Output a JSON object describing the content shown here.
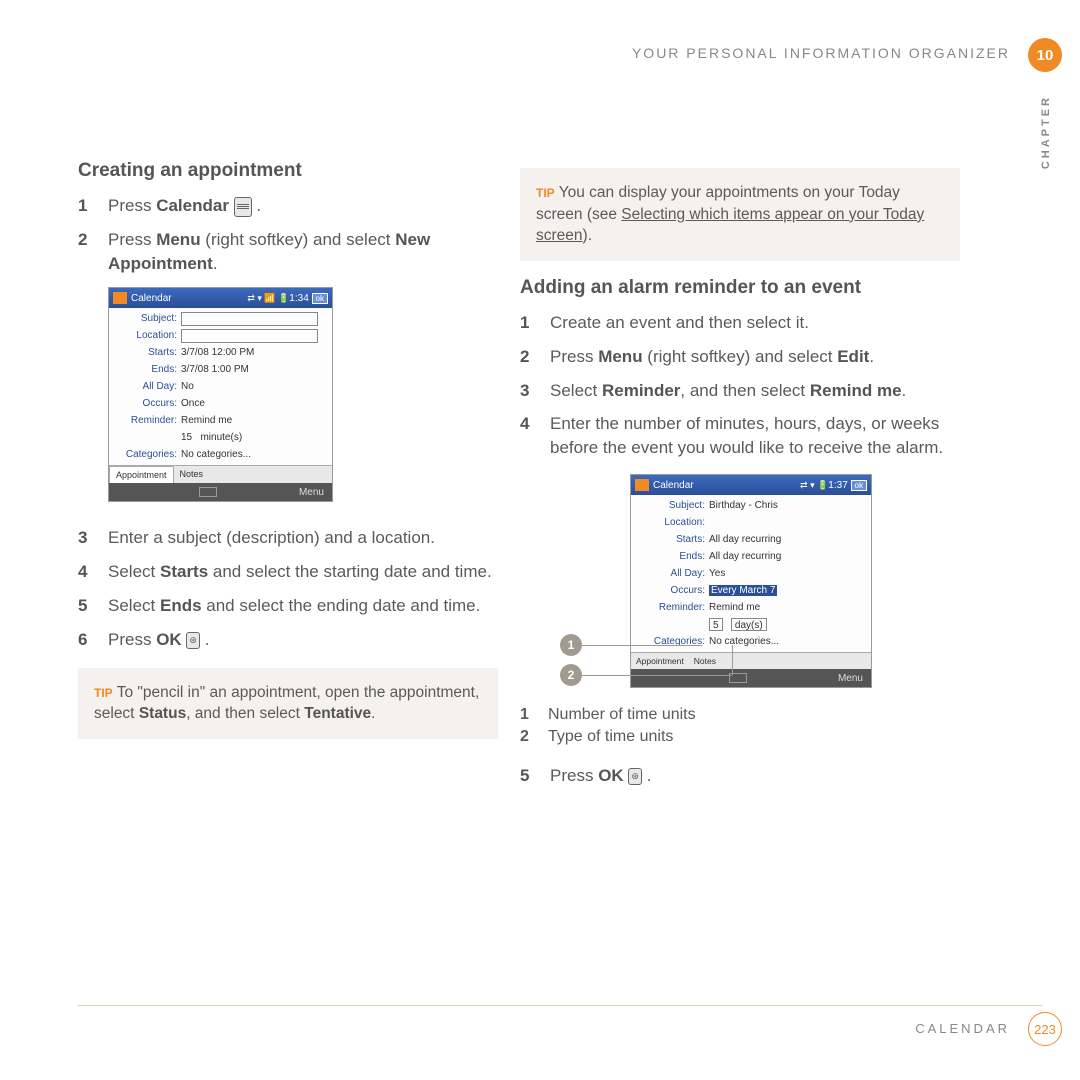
{
  "header": {
    "running_head": "YOUR PERSONAL INFORMATION ORGANIZER",
    "chapter_num": "10",
    "chapter_label": "CHAPTER"
  },
  "footer": {
    "section": "CALENDAR",
    "page": "223"
  },
  "left": {
    "heading": "Creating an appointment",
    "s1a": "Press ",
    "s1b": "Calendar",
    "s2a": "Press ",
    "s2b": "Menu",
    "s2c": " (right softkey) and select ",
    "s2d": "New Appointment",
    "s2e": ".",
    "s3": "Enter a subject (description) and a location.",
    "s4a": "Select ",
    "s4b": "Starts",
    "s4c": " and select the starting date and time.",
    "s5a": "Select ",
    "s5b": "Ends",
    "s5c": " and select the ending date and time.",
    "s6a": "Press ",
    "s6b": "OK",
    "tip_label": "TIP",
    "tip1a": " To \"pencil in\" an appointment, open the appointment, select ",
    "tip1b": "Status",
    "tip1c": ", and then select ",
    "tip1d": "Tentative",
    "tip1e": "."
  },
  "shot1": {
    "title": "Calendar",
    "time": "1:34",
    "ok": "ok",
    "subject_l": "Subject:",
    "location_l": "Location:",
    "starts_l": "Starts:",
    "starts_v": "3/7/08   12:00 PM",
    "ends_l": "Ends:",
    "ends_v": "3/7/08    1:00 PM",
    "allday_l": "All Day:",
    "allday_v": "No",
    "occurs_l": "Occurs:",
    "occurs_v": "Once",
    "reminder_l": "Reminder:",
    "reminder_v": "Remind me",
    "rem_num": "15",
    "rem_unit": "minute(s)",
    "cat_l": "Categories:",
    "cat_v": "No categories...",
    "tab1": "Appointment",
    "tab2": "Notes",
    "menu": "Menu"
  },
  "right": {
    "tip_label": "TIP",
    "tip2a": " You can display your appointments on your Today screen (see ",
    "tip2link": "Selecting which items appear on your Today screen",
    "tip2b": ").",
    "heading": "Adding an alarm reminder to an event",
    "s1": "Create an event and then select it.",
    "s2a": "Press ",
    "s2b": "Menu",
    "s2c": " (right softkey) and select ",
    "s2d": "Edit",
    "s2e": ".",
    "s3a": "Select ",
    "s3b": "Reminder",
    "s3c": ", and then select ",
    "s3d": "Remind me",
    "s3e": ".",
    "s4": "Enter the number of minutes, hours, days, or weeks before the event you would like to receive the alarm.",
    "c1": "Number of time units",
    "c2": "Type of time units",
    "s5a": "Press ",
    "s5b": "OK"
  },
  "shot2": {
    "title": "Calendar",
    "time": "1:37",
    "ok": "ok",
    "subject_l": "Subject:",
    "subject_v": "Birthday - Chris",
    "location_l": "Location:",
    "starts_l": "Starts:",
    "starts_v": "All day recurring",
    "ends_l": "Ends:",
    "ends_v": "All day recurring",
    "allday_l": "All Day:",
    "allday_v": "Yes",
    "occurs_l": "Occurs:",
    "occurs_v": "Every March 7",
    "reminder_l": "Reminder:",
    "reminder_v": "Remind me",
    "rem_num": "5",
    "rem_unit": "day(s)",
    "cat_l": "Categories:",
    "cat_v": "No categories...",
    "tab1": "Appointment",
    "tab2": "Notes",
    "menu": "Menu"
  }
}
